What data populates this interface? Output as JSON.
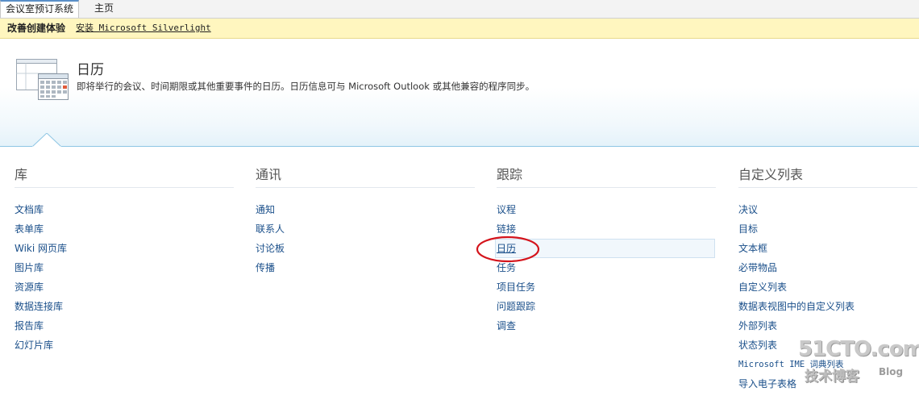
{
  "tabs": {
    "site": "会议室预订系统",
    "home": "主页"
  },
  "status": {
    "title": "改善创建体验",
    "link": "安装 Microsoft Silverlight"
  },
  "header": {
    "title": "日历",
    "description": "即将举行的会议、时间期限或其他重要事件的日历。日历信息可与 Microsoft Outlook 或其他兼容的程序同步。"
  },
  "columns": [
    {
      "heading": "库",
      "items": [
        "文档库",
        "表单库",
        "Wiki 网页库",
        "图片库",
        "资源库",
        "数据连接库",
        "报告库",
        "幻灯片库"
      ]
    },
    {
      "heading": "通讯",
      "items": [
        "通知",
        "联系人",
        "讨论板",
        "传播"
      ]
    },
    {
      "heading": "跟踪",
      "items": [
        "议程",
        "链接",
        "日历",
        "任务",
        "项目任务",
        "问题跟踪",
        "调查"
      ],
      "selected_index": 2
    },
    {
      "heading": "自定义列表",
      "items": [
        "决议",
        "目标",
        "文本框",
        "必带物品",
        "自定义列表",
        "数据表视图中的自定义列表",
        "外部列表",
        "状态列表",
        "Microsoft IME 词典列表",
        "导入电子表格"
      ]
    }
  ],
  "watermark": {
    "domain": "51CTO.com",
    "cn": "技术博客",
    "blog": "Blog"
  },
  "colors": {
    "link": "#1a4f8a",
    "status_bg": "#fff6bf",
    "accent": "#8fc6e4",
    "annotation": "#d4141c"
  },
  "icons": [
    "calendar-icon"
  ]
}
